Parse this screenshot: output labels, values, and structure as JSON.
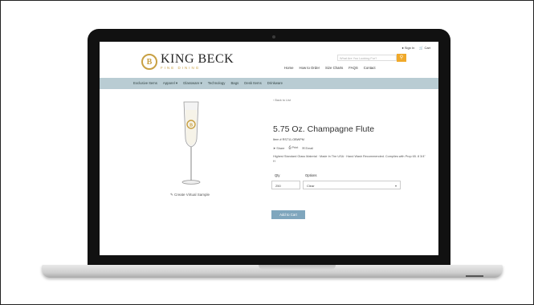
{
  "header": {
    "sign_in": "Sign In",
    "cart": "Cart",
    "logo_letter": "B",
    "brand": "KING BECK",
    "tagline": "FINE DINING",
    "search_placeholder": "What Are You Looking For?",
    "search_icon": "search-icon"
  },
  "main_nav": [
    "Home",
    "How to Order",
    "Size Charts",
    "FAQS",
    "Contact"
  ],
  "categories": [
    "Exclusive Items",
    "Apparel ▾",
    "Glassware ▾",
    "Technology",
    "Bags",
    "Desk Items",
    "Drinkware"
  ],
  "product": {
    "back": "‹ Back to List",
    "title": "5.75 Oz. Champagne Flute",
    "item_no": "Item # RS711-OBWPM",
    "share": "Share",
    "print": "Print",
    "email": "Email",
    "description": "Highest Standard Glass Material · Made In The USA · Hand Wash Recommended. Complies with Prop 65. 8 3/4\" H",
    "create_sample": "Create Virtual Sample",
    "qty_label": "Qty",
    "options_label": "Options",
    "qty_value": "250",
    "option_value": "Clear",
    "add_to_cart": "Add to Cart"
  },
  "colors": {
    "gold": "#c8a043",
    "catbar": "#b9ccd3",
    "button": "#7fa6bd",
    "search_btn": "#f0a92a"
  }
}
